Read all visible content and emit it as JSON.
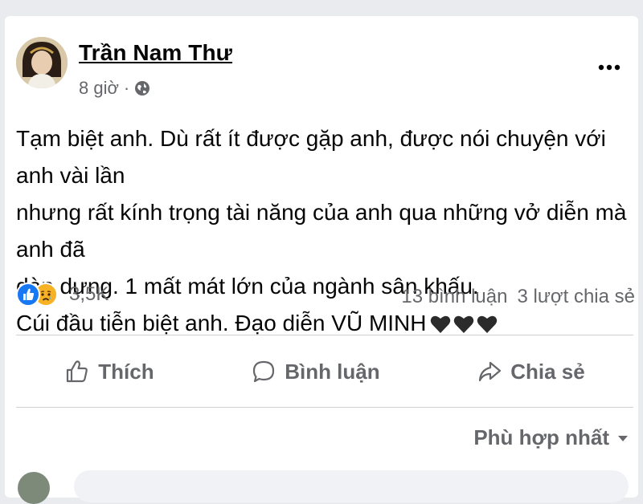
{
  "post": {
    "author": "Trần Nam Thư",
    "time": "8 giờ",
    "separator": "·",
    "text": "Tạm biệt anh. Dù rất ít được gặp anh, được nói chuyện với anh vài lần\nnhưng rất kính trọng tài năng của anh qua những vở diễn mà anh đã\ndàn dựng. 1 mất mát lớn của ngành sân khấu.\nCúi đầu tiễn biệt anh. Đạo diễn VŨ MINH",
    "hearts": [
      "black-heart-icon",
      "black-heart-icon",
      "black-heart-icon"
    ]
  },
  "reactions": {
    "icons": [
      "like-icon",
      "sad-icon"
    ],
    "count": "3,5K",
    "comments": "13 bình luận",
    "shares": "3 lượt chia sẻ"
  },
  "actions": {
    "like_label": "Thích",
    "comment_label": "Bình luận",
    "share_label": "Chia sẻ"
  },
  "comments": {
    "sort_label": "Phù hợp nhất"
  },
  "colors": {
    "like_blue": "#1877f2",
    "sad_yellow": "#f7b125",
    "secondary_text": "#65676b",
    "heart": "#2b2b2b"
  }
}
